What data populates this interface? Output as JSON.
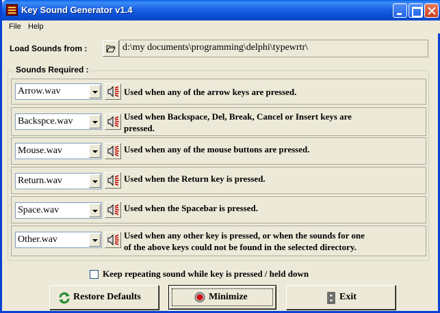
{
  "window": {
    "title": "Key Sound Generator v1.4"
  },
  "menu": {
    "items": [
      "File",
      "Help"
    ]
  },
  "load": {
    "label": "Load Sounds from :",
    "path": "d:\\my documents\\programming\\delphi\\typewrtr\\"
  },
  "group": {
    "title": "Sounds Required :"
  },
  "sounds": [
    {
      "file": "Arrow.wav",
      "desc_line1": "Used when any of the arrow keys are pressed.",
      "desc_line2": ""
    },
    {
      "file": "Backspce.wav",
      "desc_line1": "Used when Backspace, Del, Break, Cancel or Insert keys are",
      "desc_line2": "pressed."
    },
    {
      "file": "Mouse.wav",
      "desc_line1": "Used when any of the mouse buttons are pressed.",
      "desc_line2": ""
    },
    {
      "file": "Return.wav",
      "desc_line1": "Used when the Return key is pressed.",
      "desc_line2": ""
    },
    {
      "file": "Space.wav",
      "desc_line1": "Used when the Spacebar is pressed.",
      "desc_line2": ""
    },
    {
      "file": "Other.wav",
      "desc_line1": "Used when any other key is pressed, or when the sounds for one",
      "desc_line2": "of the above keys could not be found in the selected directory."
    }
  ],
  "repeat": {
    "label": "Keep repeating sound while key is pressed / held down",
    "checked": false
  },
  "buttons": {
    "restore": "Restore Defaults",
    "minimize": "Minimize",
    "exit": "Exit"
  },
  "colors": {
    "titlebar": "#0a5fe8",
    "face": "#ece9d8",
    "speaker_red": "#c00000"
  }
}
